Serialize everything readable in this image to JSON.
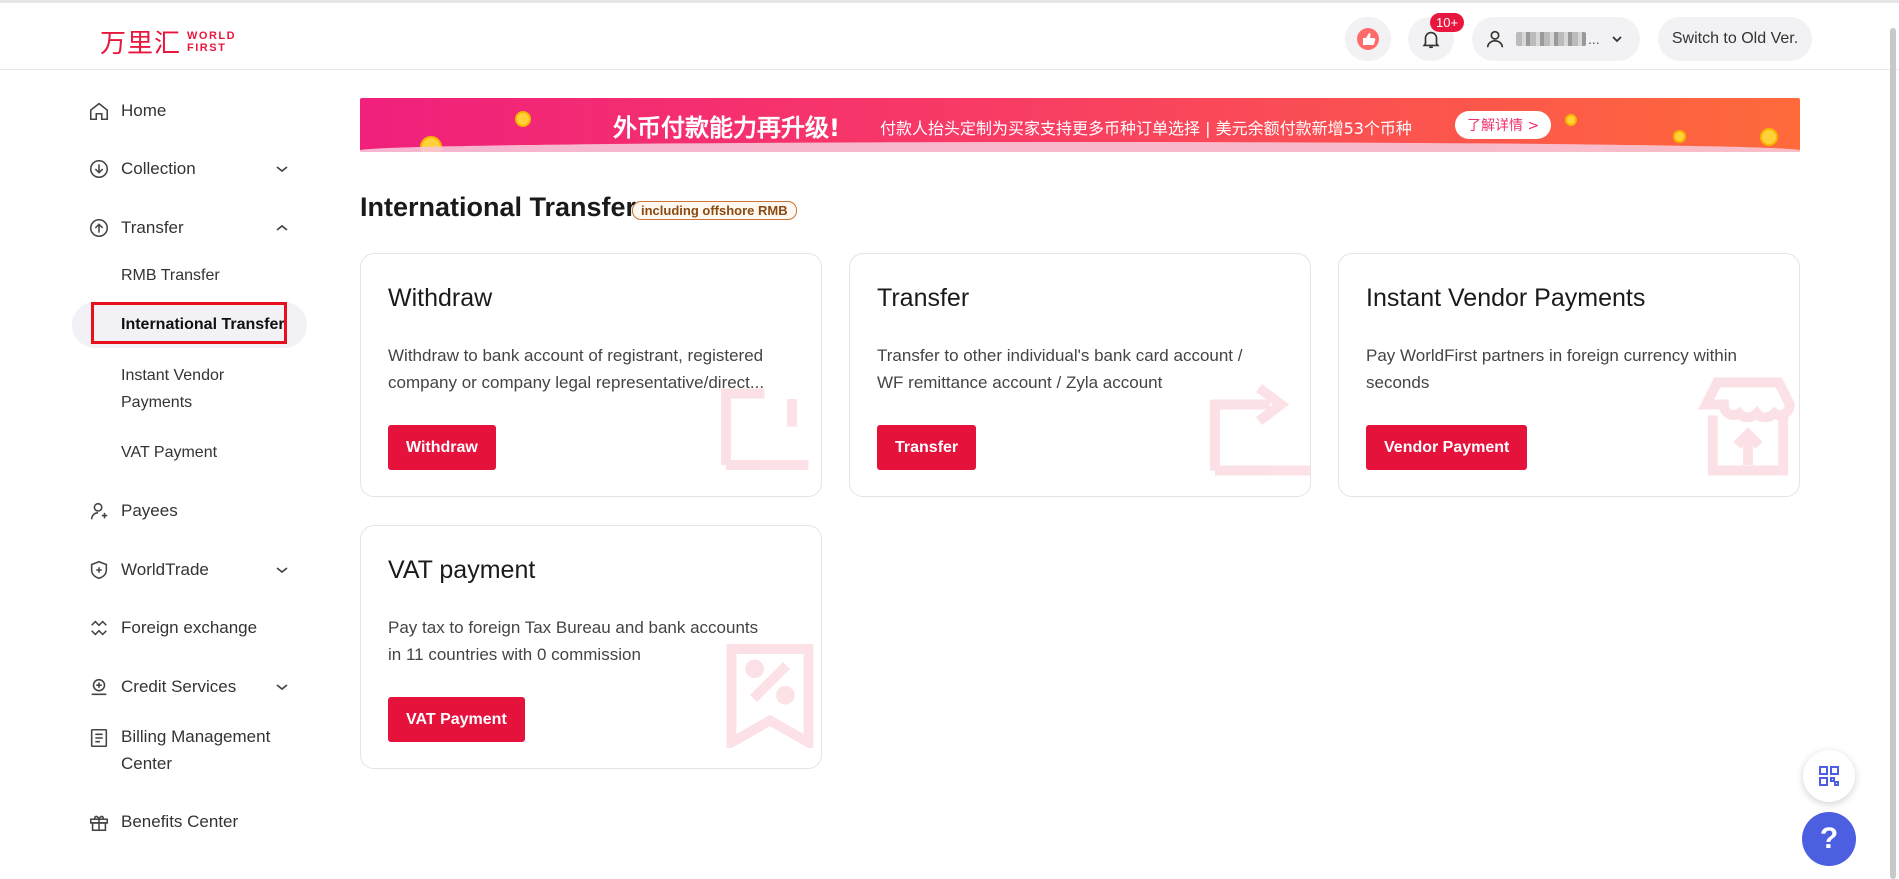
{
  "header": {
    "logo_cn": "万里汇",
    "logo_en_line1": "WORLD",
    "logo_en_line2": "FIRST",
    "notification_badge": "10+",
    "user_ellipsis": "...",
    "switch_label": "Switch to Old Ver."
  },
  "sidebar": {
    "items": [
      {
        "label": "Home",
        "icon": "home-icon"
      },
      {
        "label": "Collection",
        "icon": "collection-icon"
      },
      {
        "label": "Transfer",
        "icon": "transfer-icon"
      },
      {
        "label": "Payees",
        "icon": "payees-icon"
      },
      {
        "label": "WorldTrade",
        "icon": "worldtrade-icon"
      },
      {
        "label": "Foreign exchange",
        "icon": "foreign-exchange-icon"
      },
      {
        "label": "Credit Services",
        "icon": "credit-services-icon"
      },
      {
        "label": "Billing Management Center",
        "icon": "billing-icon"
      },
      {
        "label": "Benefits Center",
        "icon": "gift-icon"
      }
    ],
    "transfer_sub": [
      {
        "label": "RMB Transfer"
      },
      {
        "label": "International Transfer"
      },
      {
        "label": "Instant Vendor Payments"
      },
      {
        "label": "VAT Payment"
      }
    ]
  },
  "banner": {
    "title": "外币付款能力再升级!",
    "subtitle": "付款人抬头定制为买家支持更多币种订单选择 | 美元余额付款新增53个币种",
    "button": "了解详情 >"
  },
  "main": {
    "title": "International Transfer",
    "tag": "including offshore RMB",
    "cards": [
      {
        "title": "Withdraw",
        "desc1": "Withdraw to bank account of registrant, registered",
        "desc2": "company or company legal representative/direct...",
        "button": "Withdraw"
      },
      {
        "title": "Transfer",
        "desc1": "Transfer to other individual's bank card account /",
        "desc2": "WF remittance account / Zyla account",
        "button": "Transfer"
      },
      {
        "title": "Instant Vendor Payments",
        "desc1": "Pay WorldFirst partners in foreign currency within",
        "desc2": "seconds",
        "button": "Vendor Payment"
      },
      {
        "title": "VAT payment",
        "desc1": "Pay tax to foreign Tax Bureau and bank accounts",
        "desc2": "in 11 countries with 0 commission",
        "button": "VAT Payment"
      }
    ]
  },
  "floating": {
    "help": "?"
  },
  "colors": {
    "brand_red": "#e5123c",
    "help_blue": "#4b5fe0",
    "highlight_box": "#e8101c"
  }
}
